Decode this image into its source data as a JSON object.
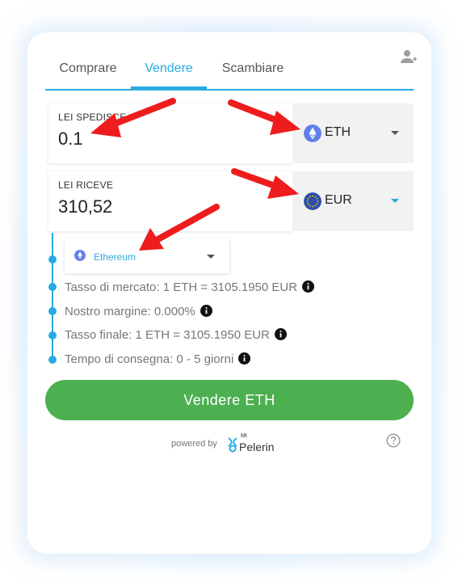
{
  "tabs": [
    {
      "label": "Comprare",
      "active": false
    },
    {
      "label": "Vendere",
      "active": true
    },
    {
      "label": "Scambiare",
      "active": false
    }
  ],
  "send": {
    "label": "LEI SPEDISCE",
    "value": "0.1",
    "currency": "ETH",
    "currency_icon": "ethereum-icon"
  },
  "receive": {
    "label": "LEI RICEVE",
    "value": "310,52",
    "currency": "EUR",
    "currency_icon": "eu-flag-icon"
  },
  "network": {
    "label": "Ethereum",
    "icon": "ethereum-icon"
  },
  "info": {
    "market_rate": "Tasso di mercato: 1 ETH = 3105.1950 EUR",
    "margin": "Nostro margine: 0.000%",
    "final_rate": "Tasso finale: 1 ETH = 3105.1950 EUR",
    "delivery": "Tempo di consegna: 0 - 5 giorni"
  },
  "cta_label": "Vendere ETH",
  "footer": {
    "powered_by": "powered by",
    "brand_mt": "Mt",
    "brand_name": "Pelerin"
  },
  "colors": {
    "accent": "#29abe2",
    "cta": "#4caf50",
    "annotation_arrow": "#ee1c1c"
  }
}
